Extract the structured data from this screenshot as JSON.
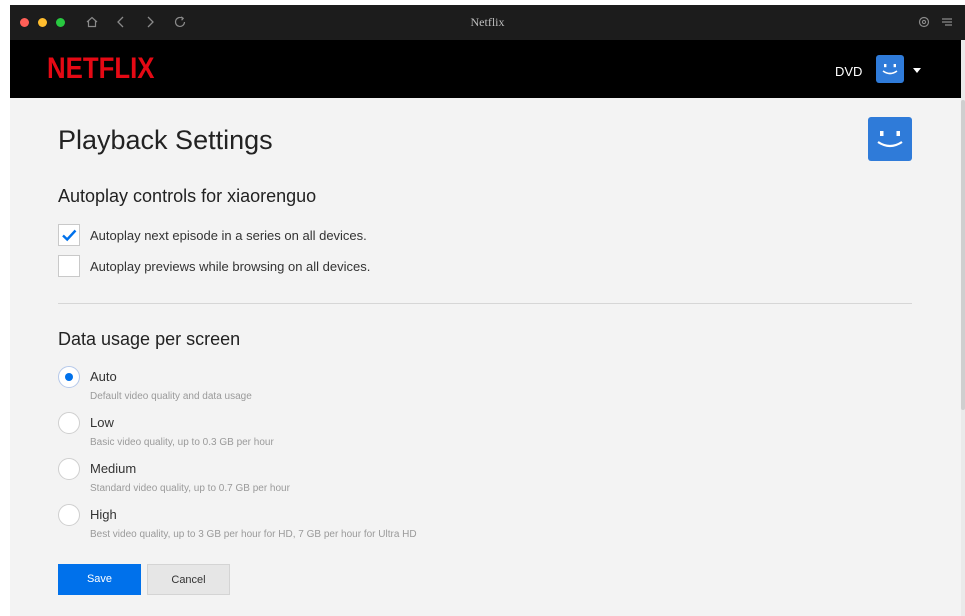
{
  "window": {
    "title": "Netflix"
  },
  "header": {
    "logo_text": "NETFLIX",
    "profile_name": "DVD"
  },
  "page": {
    "title": "Playback Settings"
  },
  "autoplay": {
    "heading": "Autoplay controls for xiaorenguo",
    "options": [
      {
        "label": "Autoplay next episode in a series on all devices.",
        "checked": true
      },
      {
        "label": "Autoplay previews while browsing on all devices.",
        "checked": false
      }
    ]
  },
  "data_usage": {
    "heading": "Data usage per screen",
    "selected": "Auto",
    "options": [
      {
        "label": "Auto",
        "description": "Default video quality and data usage"
      },
      {
        "label": "Low",
        "description": "Basic video quality, up to 0.3 GB per hour"
      },
      {
        "label": "Medium",
        "description": "Standard video quality, up to 0.7 GB per hour"
      },
      {
        "label": "High",
        "description": "Best video quality, up to 3 GB per hour for HD, 7 GB per hour for Ultra HD"
      }
    ]
  },
  "actions": {
    "save_label": "Save",
    "cancel_label": "Cancel"
  },
  "colors": {
    "brand_red": "#e50914",
    "accent_blue": "#0071eb",
    "avatar_blue": "#2f7bd9"
  },
  "icons": {
    "home": "home-icon",
    "back": "chevron-left-icon",
    "forward": "chevron-right-icon",
    "reload": "reload-icon",
    "settings": "gear-icon",
    "menu": "menu-icon"
  }
}
